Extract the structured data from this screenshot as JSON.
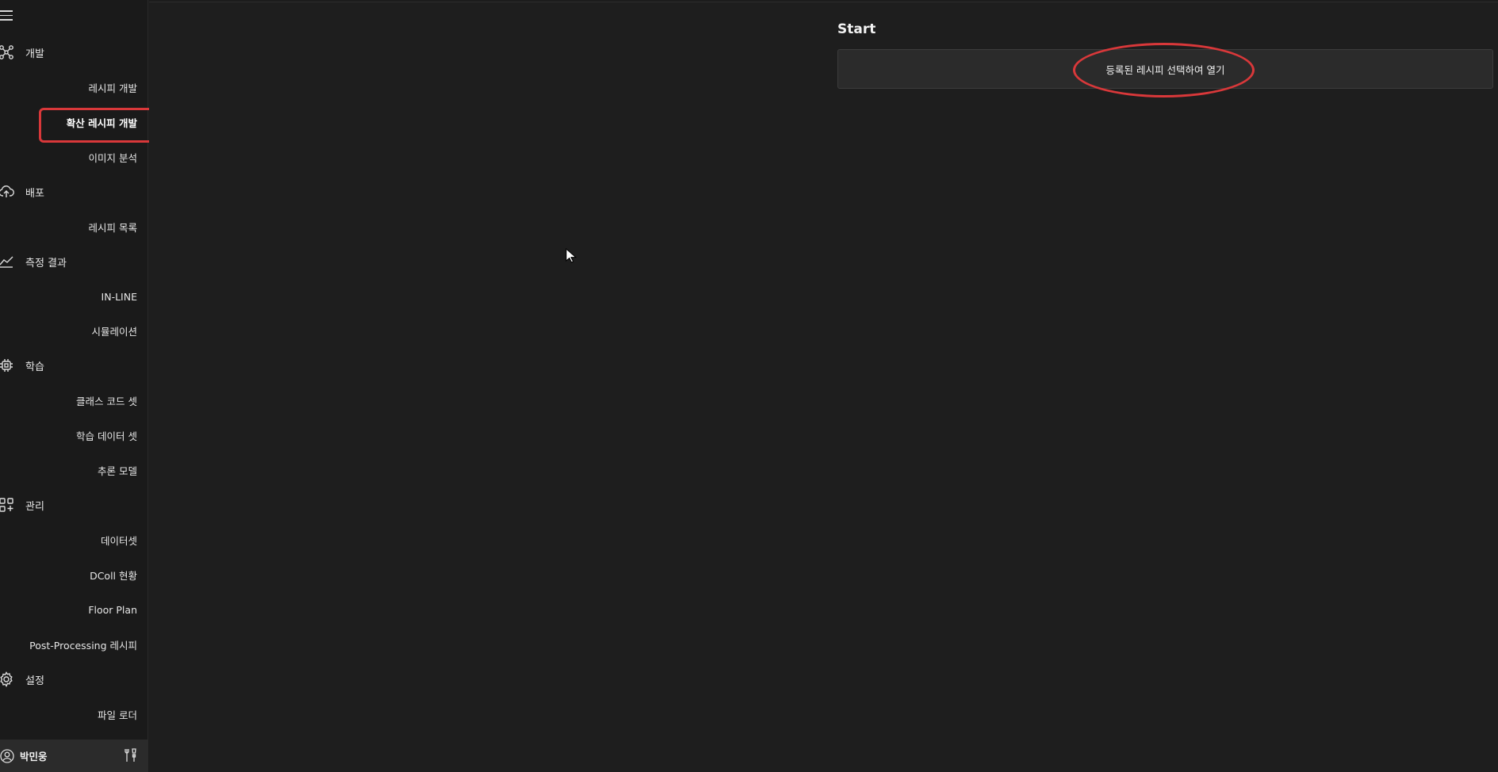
{
  "sidebar": {
    "menu_icon": "hamburger-menu-icon",
    "groups": {
      "dev": {
        "label": "개발",
        "icon": "network-nodes-icon",
        "items": [
          "레시피 개발",
          "확산 레시피 개발",
          "이미지 분석"
        ]
      },
      "deploy": {
        "label": "배포",
        "icon": "cloud-upload-icon",
        "items": [
          "레시피 목록"
        ]
      },
      "results": {
        "label": "측정 결과",
        "icon": "line-chart-icon",
        "items": [
          "IN-LINE",
          "시뮬레이션"
        ]
      },
      "learning": {
        "label": "학습",
        "icon": "chip-icon",
        "items": [
          "클래스 코드 셋",
          "학습 데이터 셋",
          "추론 모델"
        ]
      },
      "manage": {
        "label": "관리",
        "icon": "apps-add-icon",
        "items": [
          "데이터셋",
          "DColl 현황",
          "Floor Plan",
          "Post-Processing 레시피"
        ]
      },
      "settings": {
        "label": "설정",
        "icon": "gear-icon",
        "items": [
          "파일 로더"
        ]
      }
    },
    "active_item": "확산 레시피 개발"
  },
  "user": {
    "name": "박민웅",
    "avatar_icon": "user-circle-icon",
    "tools_icon": "tools-icon"
  },
  "main": {
    "section_title": "Start",
    "open_button_label": "등록된 레시피 선택하여 열기"
  },
  "colors": {
    "highlight": "#d9383a",
    "background": "#1e1e1e",
    "sidebar": "#1a1a1a"
  }
}
